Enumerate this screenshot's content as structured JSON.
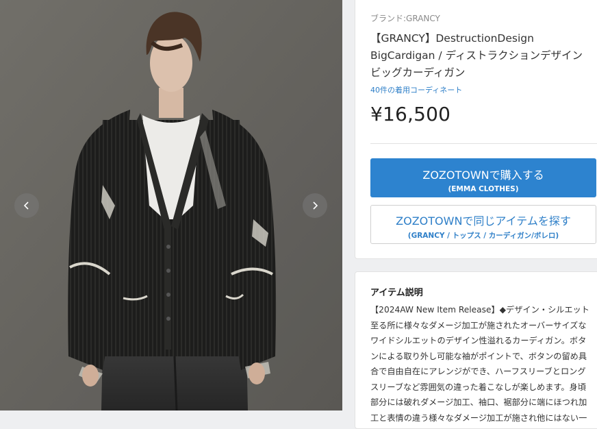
{
  "product": {
    "brand_label": "ブランド:GRANCY",
    "title_lines": [
      "【GRANCY】DestructionDesign",
      "BigCardigan / ディストラクションデザイン",
      "ビッグカーディガン"
    ],
    "coordinate_link": "40件の着用コーディネート",
    "price": "¥16,500"
  },
  "buttons": {
    "buy": {
      "label": "ZOZOTOWNで購入する",
      "sub": "(EMMA CLOTHES)",
      "color": "#2d83cf"
    },
    "search": {
      "label": "ZOZOTOWNで同じアイテムを探す",
      "sub": "(GRANCY / トップス / カーディガン/ボレロ)",
      "color": "#2e7fc8"
    }
  },
  "gallery": {
    "prev_icon": "chevron-left-icon",
    "next_icon": "chevron-right-icon"
  },
  "description": {
    "heading": "アイテム説明",
    "lines": [
      "【2024AW New Item Release】◆デザイン・シルエット",
      "至る所に様々なダメージ加工が施されたオーバーサイズな",
      "ワイドシルエットのデザイン性溢れるカーディガン。ボタ",
      "ンによる取り外し可能な袖がポイントで、ボタンの留め具",
      "合で自由自在にアレンジができ、ハーフスリーブとロング",
      "スリーブなど雰囲気の違った着こなしが楽しめます。身頃",
      "部分には破れダメージ加工、袖口、裾部分に端にほつれ加",
      "工と表情の違う様々なダメージ加工が施され他にはない一"
    ]
  }
}
